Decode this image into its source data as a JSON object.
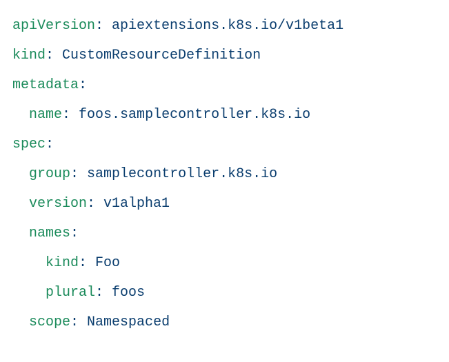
{
  "yaml": {
    "apiVersion": {
      "key": "apiVersion",
      "value": "apiextensions.k8s.io/v1beta1"
    },
    "kind": {
      "key": "kind",
      "value": "CustomResourceDefinition"
    },
    "metadata": {
      "key": "metadata"
    },
    "metadata_name": {
      "key": "name",
      "value": "foos.samplecontroller.k8s.io"
    },
    "spec": {
      "key": "spec"
    },
    "spec_group": {
      "key": "group",
      "value": "samplecontroller.k8s.io"
    },
    "spec_version": {
      "key": "version",
      "value": "v1alpha1"
    },
    "spec_names": {
      "key": "names"
    },
    "spec_names_kind": {
      "key": "kind",
      "value": "Foo"
    },
    "spec_names_plural": {
      "key": "plural",
      "value": "foos"
    },
    "spec_scope": {
      "key": "scope",
      "value": "Namespaced"
    }
  }
}
